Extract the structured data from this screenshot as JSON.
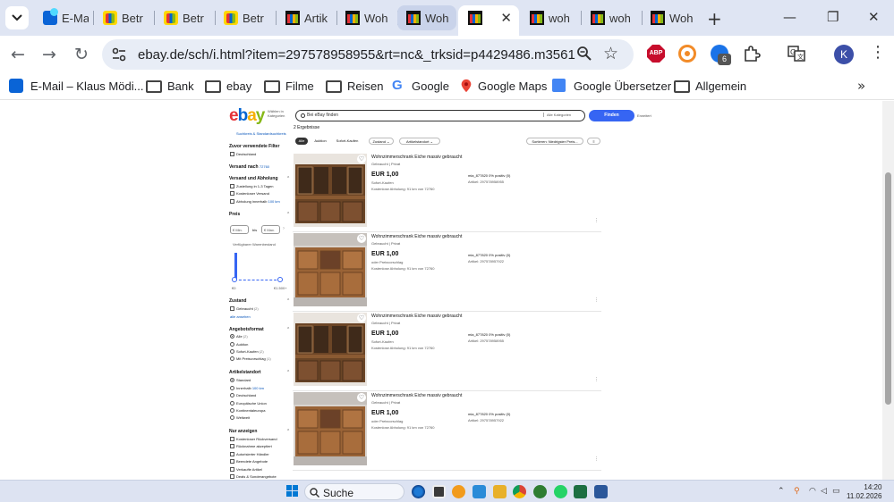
{
  "browser": {
    "tabs": [
      {
        "title": "E-Mail",
        "icon": "outlook-icon"
      },
      {
        "title": "Betr",
        "icon": "ebay-bag-icon"
      },
      {
        "title": "Betr",
        "icon": "ebay-bag-icon"
      },
      {
        "title": "Betr",
        "icon": "ebay-bag-icon"
      },
      {
        "title": "Artik",
        "icon": "ebay-icon"
      },
      {
        "title": "Woh",
        "icon": "ebay-icon"
      },
      {
        "title": "Woh",
        "icon": "ebay-icon"
      },
      {
        "title": "",
        "icon": "ebay-icon",
        "active": true
      },
      {
        "title": "woh",
        "icon": "ebay-icon"
      },
      {
        "title": "woh",
        "icon": "ebay-icon"
      },
      {
        "title": "Woh",
        "icon": "ebay-icon"
      }
    ],
    "url": "ebay.de/sch/i.html?item=297578958955&rt=nc&_trksid=p4429486.m3561.l17...",
    "extension_badge": "6",
    "extension_abp": "ABP",
    "profile_initial": "K",
    "bookmarks": [
      {
        "label": "E-Mail – Klaus Mödi...",
        "icon": "outlook-icon"
      },
      {
        "label": "Bank",
        "icon": "folder-icon"
      },
      {
        "label": "ebay",
        "icon": "folder-icon"
      },
      {
        "label": "Filme",
        "icon": "folder-icon"
      },
      {
        "label": "Reisen",
        "icon": "folder-icon"
      },
      {
        "label": "Google",
        "icon": "google-icon"
      },
      {
        "label": "Google Maps",
        "icon": "maps-pin-icon"
      },
      {
        "label": "Google Übersetzer",
        "icon": "translate-icon"
      },
      {
        "label": "Allgemein",
        "icon": "folder-icon"
      }
    ]
  },
  "ebay": {
    "logo": {
      "e": "e",
      "b": "b",
      "a": "a",
      "y": "y"
    },
    "ship_to": "Wählen in Kategorien",
    "search_placeholder": "Bei eBay finden",
    "category": "Alle Kategorien",
    "search_button": "Finden",
    "advanced": "Erweitert",
    "result_count": "2 Ergebnisse",
    "sidebar": {
      "top_link": "Suchkreis & Standardsuchkreis",
      "related_head": "Zuvor verwendete Filter",
      "related_item": "Deutschland",
      "ship_to_head": "Versand nach",
      "ship_to_value": "72760",
      "shipping_head": "Versand und Abholung",
      "shipping_options": [
        "Zustellung in 1-3 Tagen",
        "Kostenloser Versand",
        "Abholung innerhalb"
      ],
      "shipping_radius": "100 km",
      "price_head": "Preis",
      "price_min": "€ Min.",
      "price_to": "bis",
      "price_max": "€ Max.",
      "price_range_label": "Verfügbarer Warenbestand",
      "price_low": "€0",
      "price_high": "€1.500+",
      "condition_head": "Zustand",
      "condition_item": "Gebraucht",
      "condition_count": "(2)",
      "show_all": "alle ansehen",
      "format_head": "Angebotsformat",
      "format_options": [
        {
          "label": "Alle",
          "count": "(2)",
          "checked": true
        },
        {
          "label": "Auktion",
          "count": "",
          "checked": false
        },
        {
          "label": "Sofort-Kaufen",
          "count": "(2)",
          "checked": false
        },
        {
          "label": "Mit Preisvorschlag",
          "count": "(1)",
          "checked": false
        }
      ],
      "location_head": "Artikelstandort",
      "location_options": [
        {
          "label": "Standard",
          "checked": true
        },
        {
          "label": "Innerhalb",
          "extra": "100 km",
          "checked": false
        },
        {
          "label": "Deutschland",
          "checked": false
        },
        {
          "label": "Europäische Union",
          "checked": false
        },
        {
          "label": "Kontinentaleuropa",
          "checked": false
        },
        {
          "label": "Weltweit",
          "checked": false
        }
      ],
      "show_only_head": "Nur anzeigen",
      "show_only_options": [
        "Kostenloser Rückversand",
        "Rücknahme akzeptiert",
        "Autorisierter Händler",
        "Beendete Angebote",
        "Verkaufte Artikel",
        "Deals & Sonderangebote"
      ]
    },
    "filters": {
      "all": "Alle",
      "auction": "Auktion",
      "buy_now": "Sofort-Kaufen",
      "condition": "Zustand",
      "location": "Artikelstandort",
      "sort": "Sortieren: Niedrigster Preis...",
      "view": "≡"
    },
    "listings": [
      {
        "title": "Wohnzimmerschrank Eiche massiv gebraucht",
        "condition": "Gebraucht | Privat",
        "price": "EUR 1,00",
        "mode": "Sofort-Kaufen",
        "pickup": "Kostenlose Abholung: 91 km von 72760",
        "seller": "mia_877820 0% positiv (0)",
        "artnr": "Artikel: 297578958955",
        "type": "cabinet-glass"
      },
      {
        "title": "Wohnzimmerschrank Eiche massiv gebraucht",
        "condition": "Gebraucht | Privat",
        "price": "EUR 1,00",
        "mode": "oder Preisvorschlag",
        "pickup": "Kostenlose Abholung: 91 km von 72760",
        "seller": "mia_877820 0% positiv (0)",
        "artnr": "Artikel: 297578957922",
        "type": "sideboard"
      },
      {
        "title": "Wohnzimmerschrank Eiche massiv gebraucht",
        "condition": "Gebraucht | Privat",
        "price": "EUR 1,00",
        "mode": "Sofort-Kaufen",
        "pickup": "Kostenlose Abholung: 91 km von 72760",
        "seller": "mia_877820 0% positiv (0)",
        "artnr": "Artikel: 297578958955",
        "type": "cabinet-glass"
      },
      {
        "title": "Wohnzimmerschrank Eiche massiv gebraucht",
        "condition": "Gebraucht | Privat",
        "price": "EUR 1,00",
        "mode": "oder Preisvorschlag",
        "pickup": "Kostenlose Abholung: 91 km von 72760",
        "seller": "mia_877820 0% positiv (0)",
        "artnr": "Artikel: 297578957922",
        "type": "sideboard"
      }
    ]
  },
  "taskbar": {
    "search_label": "Suche",
    "time": "14:20",
    "date": "11.02.2026"
  },
  "colors": {
    "ebay_red": "#e53238",
    "ebay_blue": "#0064d2",
    "ebay_yellow": "#f5af02",
    "ebay_green": "#86b817",
    "finden_button": "#3665f3",
    "tabstrip": "#dfe5f3"
  }
}
